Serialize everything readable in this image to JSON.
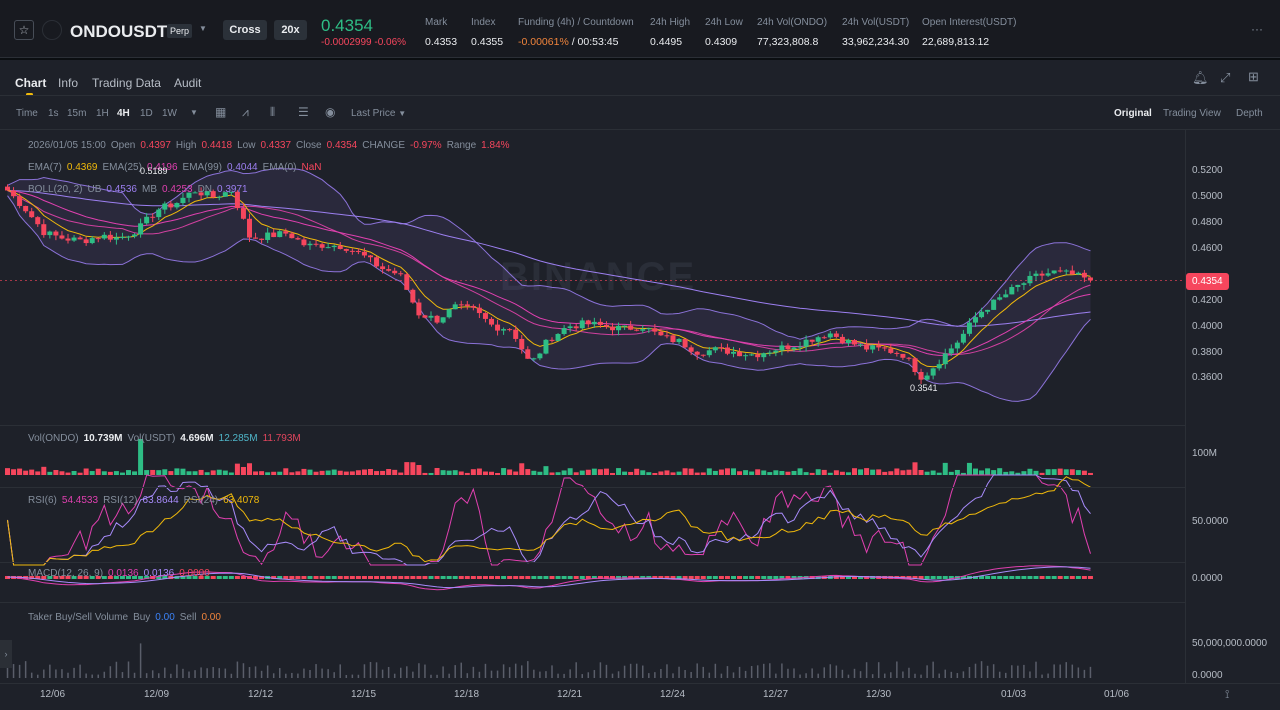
{
  "header": {
    "symbol": "ONDOUSDT",
    "contract_type": "Perp",
    "margin_mode": "Cross",
    "leverage": "20x",
    "last_price": "0.4354",
    "change_abs": "-0.0002999",
    "change_pct": "-0.06%",
    "stats": [
      {
        "label": "Mark",
        "value": "0.4353"
      },
      {
        "label": "Index",
        "value": "0.4355"
      },
      {
        "label": "Funding (4h) / Countdown",
        "value": "-0.00061%",
        "value2": " / 00:53:45"
      },
      {
        "label": "24h High",
        "value": "0.4495"
      },
      {
        "label": "24h Low",
        "value": "0.4309"
      },
      {
        "label": "24h Vol(ONDO)",
        "value": "77,323,808.8"
      },
      {
        "label": "24h Vol(USDT)",
        "value": "33,962,234.30"
      },
      {
        "label": "Open Interest(USDT)",
        "value": "22,689,813.12"
      }
    ],
    "more": "···"
  },
  "tabs": [
    "Chart",
    "Info",
    "Trading Data",
    "Audit"
  ],
  "toolbar": {
    "intervals": [
      "Time",
      "1s",
      "15m",
      "1H",
      "4H",
      "1D",
      "1W"
    ],
    "active": "4H",
    "price_type": "Last Price",
    "views": [
      "Original",
      "Trading View",
      "Depth"
    ]
  },
  "ohlc": {
    "date": "2026/01/05 15:00",
    "open_l": "Open",
    "open": "0.4397",
    "high_l": "High",
    "high": "0.4418",
    "low_l": "Low",
    "low": "0.4337",
    "close_l": "Close",
    "close": "0.4354",
    "change_l": "CHANGE",
    "change": "-0.97%",
    "range_l": "Range",
    "range": "1.84%"
  },
  "ema": {
    "l7": "EMA(7)",
    "v7": "0.4369",
    "l25": "EMA(25)",
    "v25": "0.4196",
    "l99": "EMA(99)",
    "v99": "0.4044",
    "l0": "EMA(0)",
    "v0": "NaN"
  },
  "boll": {
    "label": "BOLL(20, 2)",
    "ub_l": "UB",
    "ub": "0.4536",
    "mb_l": "MB",
    "mb": "0.4253",
    "dn_l": "DN",
    "dn": "0.3971"
  },
  "markers": {
    "high": "0.5189",
    "low": "0.3541"
  },
  "watermark": "BINANCE",
  "volume": {
    "label": "Vol(ONDO)",
    "ondo": "10.739M",
    "usdt_l": "Vol(USDT)",
    "usdt": "4.696M",
    "ma1": "12.285M",
    "ma2": "11.793M",
    "axis": "100M"
  },
  "rsi": {
    "l6": "RSI(6)",
    "v6": "54.4533",
    "l12": "RSI(12)",
    "v12": "63.8644",
    "l24": "RSI(24)",
    "v24": "63.4078",
    "axis": "50.0000"
  },
  "macd": {
    "label": "MACD(12, 26, 9)",
    "dif": "0.0136",
    "dea": "0.0136",
    "hist": "0.0000",
    "axis": "0.0000"
  },
  "taker": {
    "label": "Taker Buy/Sell Volume",
    "buy_l": "Buy",
    "buy": "0.00",
    "sell_l": "Sell",
    "sell": "0.00",
    "axis1": "50,000,000.0000",
    "axis2": "0.0000"
  },
  "colors": {
    "up": "#2ebd85",
    "down": "#f6465d",
    "bg": "#1e2129"
  },
  "chart_data": {
    "type": "candlestick",
    "title": "ONDOUSDT Perp 4H",
    "y_ticks": [
      "0.5200",
      "0.5000",
      "0.4800",
      "0.4600",
      "0.4200",
      "0.4000",
      "0.3800",
      "0.3600"
    ],
    "ylim": [
      0.345,
      0.535
    ],
    "current_price": "0.4354",
    "x_ticks": [
      "12/06",
      "12/09",
      "12/12",
      "12/15",
      "12/18",
      "12/21",
      "12/24",
      "12/27",
      "12/30",
      "01/03",
      "01/06"
    ],
    "close_keypoints": [
      0.505,
      0.49,
      0.472,
      0.468,
      0.466,
      0.47,
      0.468,
      0.475,
      0.49,
      0.495,
      0.505,
      0.5,
      0.505,
      0.468,
      0.47,
      0.472,
      0.462,
      0.463,
      0.462,
      0.455,
      0.445,
      0.44,
      0.41,
      0.405,
      0.415,
      0.412,
      0.4,
      0.398,
      0.37,
      0.39,
      0.4,
      0.402,
      0.4,
      0.398,
      0.4,
      0.392,
      0.388,
      0.38,
      0.382,
      0.38,
      0.378,
      0.382,
      0.385,
      0.39,
      0.395,
      0.388,
      0.383,
      0.382,
      0.378,
      0.36,
      0.375,
      0.39,
      0.41,
      0.42,
      0.43,
      0.438,
      0.442,
      0.44,
      0.4354
    ]
  }
}
